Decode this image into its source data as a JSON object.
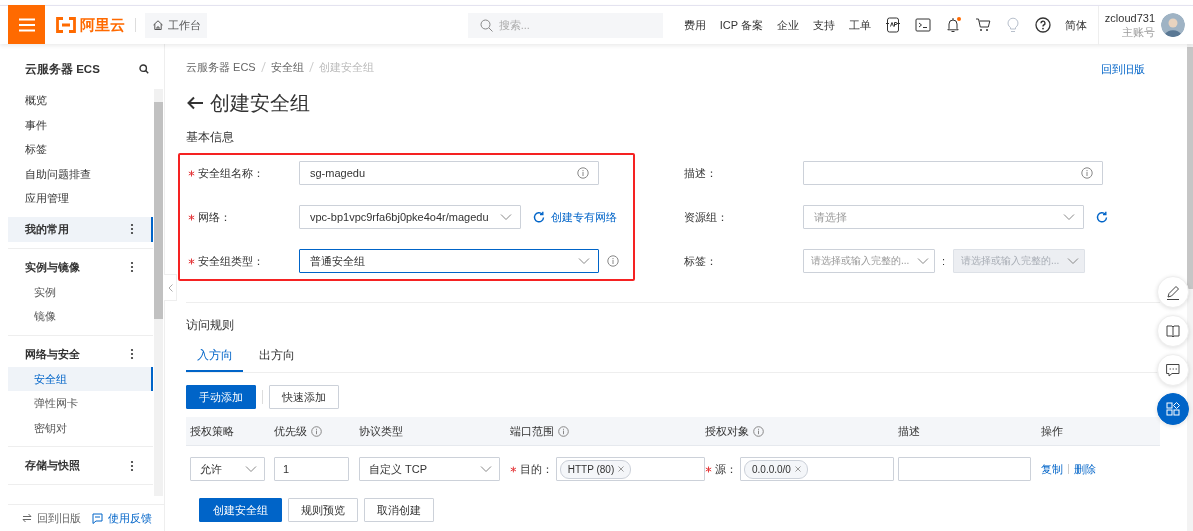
{
  "topbar": {
    "logo": "阿里云",
    "workbench": "工作台",
    "search": {
      "placeholder": "搜索..."
    },
    "links": [
      "费用",
      "ICP 备案",
      "企业",
      "支持",
      "工单"
    ],
    "bell_badge": true,
    "language": "简体",
    "user": {
      "name": "zcloud731",
      "role": "主账号"
    }
  },
  "sidebar": {
    "title": "云服务器 ECS",
    "items": [
      {
        "label": "概览",
        "selected": false
      },
      {
        "label": "事件",
        "selected": false
      },
      {
        "label": "标签",
        "selected": false
      },
      {
        "label": "自助问题排查",
        "selected": false
      },
      {
        "label": "应用管理",
        "selected": false
      }
    ],
    "groups": [
      {
        "label": "我的常用",
        "selected": true
      },
      {
        "label": "实例与镜像",
        "selected": false,
        "children": [
          {
            "label": "实例",
            "selected": false
          },
          {
            "label": "镜像",
            "selected": false
          }
        ]
      },
      {
        "label": "网络与安全",
        "selected": false,
        "children": [
          {
            "label": "安全组",
            "selected": true
          },
          {
            "label": "弹性网卡",
            "selected": false
          },
          {
            "label": "密钥对",
            "selected": false
          }
        ]
      },
      {
        "label": "存储与快照",
        "selected": false
      }
    ],
    "footer": {
      "back": "回到旧版",
      "feedback": "使用反馈"
    }
  },
  "breadcrumb": [
    "云服务器 ECS",
    "安全组",
    "创建安全组"
  ],
  "old_version_link": "回到旧版",
  "page_title": "创建安全组",
  "basic_info": {
    "title": "基本信息",
    "highlight_box": true,
    "left_fields": [
      {
        "label": "安全组名称：",
        "required": true,
        "kind": "input",
        "value": "sg-magedu",
        "focused": false
      },
      {
        "label": "网络：",
        "required": true,
        "kind": "select",
        "value": "vpc-bp1vpc9rfa6bj0pke4o4r/magedu",
        "focused": false,
        "refresh": true,
        "link": "创建专有网络"
      },
      {
        "label": "安全组类型：",
        "required": true,
        "kind": "select",
        "value": "普通安全组",
        "focused": true,
        "info": true
      }
    ],
    "right_fields": [
      {
        "label": "描述：",
        "required": false,
        "kind": "input",
        "focused": false
      },
      {
        "label": "资源组：",
        "required": false,
        "kind": "select",
        "placeholder": "请选择",
        "focused": false,
        "refresh": true
      },
      {
        "label": "标签：",
        "required": false,
        "kind": "select_pair",
        "separator": ":",
        "selects": [
          {
            "placeholder": "请选择或输入完整的...",
            "disabled": false
          },
          {
            "placeholder": "请选择或输入完整的...",
            "disabled": true
          }
        ]
      }
    ]
  },
  "access_rules": {
    "title": "访问规则",
    "tabs": [
      {
        "label": "入方向",
        "selected": true
      },
      {
        "label": "出方向",
        "selected": false
      }
    ],
    "buttons": [
      {
        "label": "手动添加",
        "primary": true
      },
      {
        "label": "快速添加",
        "primary": false
      }
    ],
    "columns": [
      {
        "label": "授权策略",
        "info": false
      },
      {
        "label": "优先级",
        "info": true
      },
      {
        "label": "协议类型",
        "info": false
      },
      {
        "label": "端口范围",
        "info": true
      },
      {
        "label": "授权对象",
        "info": true
      },
      {
        "label": "描述",
        "info": false
      },
      {
        "label": "操作",
        "info": false
      }
    ],
    "rows": [
      {
        "cells": [
          {
            "kind": "select",
            "value": "允许"
          },
          {
            "kind": "input",
            "value": "1"
          },
          {
            "kind": "select",
            "value": "自定义 TCP"
          },
          {
            "kind": "tags",
            "label": "目的：",
            "required": true,
            "tags": [
              "HTTP (80)"
            ]
          },
          {
            "kind": "tags",
            "label": "源：",
            "required": true,
            "tags": [
              "0.0.0.0/0"
            ]
          },
          {
            "kind": "input"
          },
          {
            "kind": "actions",
            "links": [
              "复制",
              "删除"
            ]
          }
        ]
      }
    ]
  },
  "footer_buttons": [
    {
      "label": "创建安全组",
      "primary": true
    },
    {
      "label": "规则预览",
      "primary": false
    },
    {
      "label": "取消创建",
      "primary": false
    }
  ],
  "floating_tools": [
    {
      "kind": "edit",
      "selected": false
    },
    {
      "kind": "docs",
      "selected": false
    },
    {
      "kind": "chat",
      "selected": false
    },
    {
      "kind": "apps",
      "selected": true
    }
  ]
}
